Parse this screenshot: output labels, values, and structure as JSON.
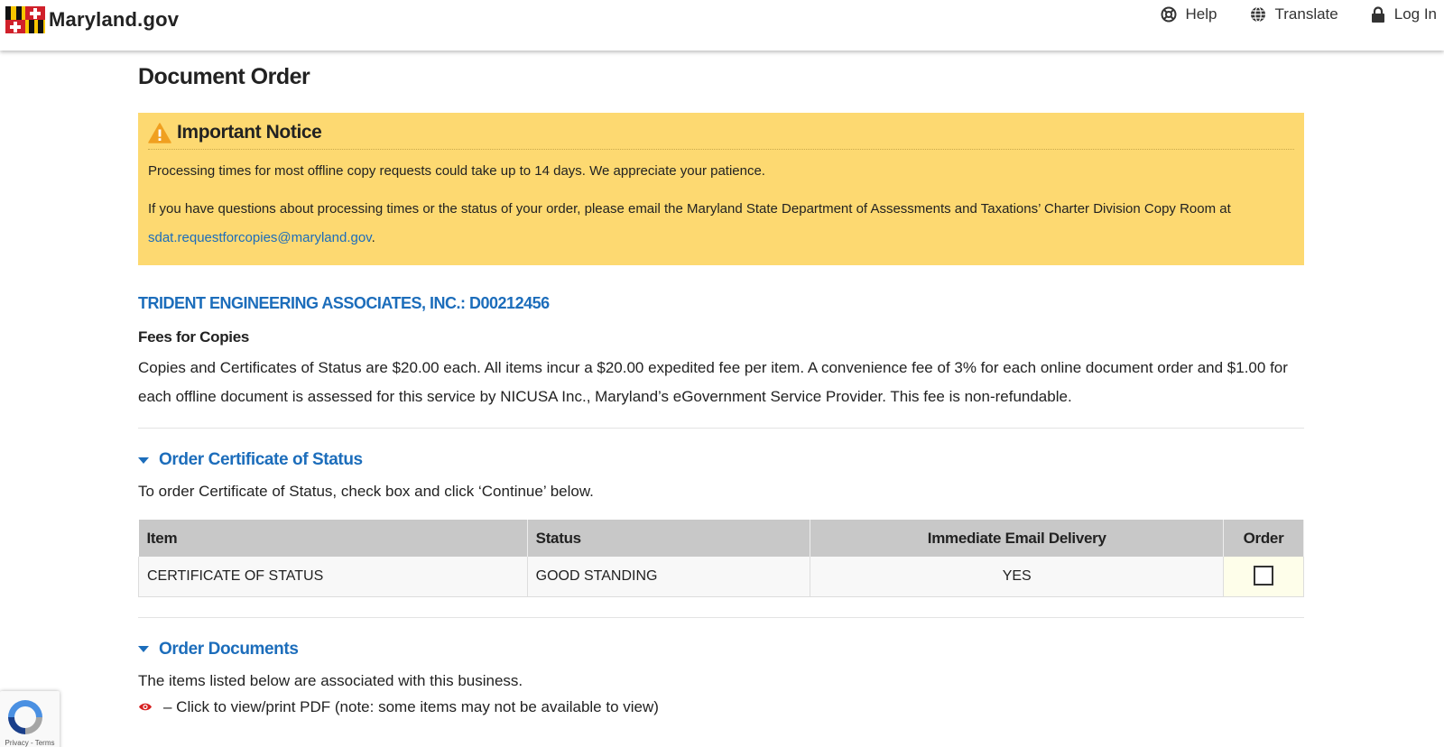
{
  "header": {
    "logo_text": "Maryland.gov",
    "nav": {
      "help": "Help",
      "translate": "Translate",
      "login": "Log In"
    }
  },
  "page": {
    "title": "Document Order"
  },
  "notice": {
    "title": "Important Notice",
    "line1": "Processing times for most offline copy requests could take up to 14 days. We appreciate your patience.",
    "line2": "If you have questions about processing times or the status of your order, please email the Maryland State Department of Assessments and Taxations’ Charter Division Copy Room at",
    "email": "sdat.requestforcopies@maryland.gov",
    "email_suffix": ".",
    "colors": {
      "background": "#fdd971",
      "icon": "#f0a020"
    }
  },
  "entity": {
    "title": "TRIDENT ENGINEERING ASSOCIATES, INC.: D00212456"
  },
  "fees": {
    "title": "Fees for Copies",
    "text": "Copies and Certificates of Status are $20.00 each. All items incur a $20.00 expedited fee per item. A convenience fee of 3% for each online document order and $1.00 for each offline document is assessed for this service by NICUSA Inc., Maryland’s eGovernment Service Provider. This fee is non-refundable."
  },
  "certificate_section": {
    "title": "Order Certificate of Status",
    "description": "To order Certificate of Status, check box and click ‘Continue’ below.",
    "table": {
      "headers": [
        "Item",
        "Status",
        "Immediate Email Delivery",
        "Order"
      ],
      "rows": [
        {
          "item": "CERTIFICATE OF STATUS",
          "status": "GOOD STANDING",
          "email_delivery": "YES",
          "order_checked": false
        }
      ]
    }
  },
  "documents_section": {
    "title": "Order Documents",
    "description": "The items listed below are associated with this business.",
    "legend": "– Click to view/print PDF (note: some items may not be available to view)"
  },
  "recaptcha": {
    "links": "Privacy - Terms"
  },
  "colors": {
    "link": "#1c6dbb",
    "table_header": "#c8c8c8",
    "eye_icon": "#d62020"
  }
}
